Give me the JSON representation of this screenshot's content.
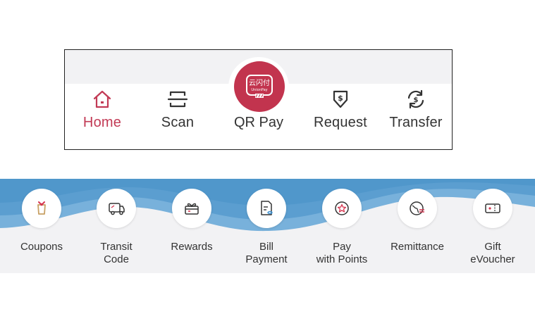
{
  "tabbar": {
    "tabs": [
      {
        "label": "Home"
      },
      {
        "label": "Scan"
      },
      {
        "label": "QR Pay",
        "logo_text": "云闪付",
        "logo_sub": "UnionPay"
      },
      {
        "label": "Request"
      },
      {
        "label": "Transfer"
      }
    ],
    "active_color": "#c23a55",
    "accent": "#c2344e"
  },
  "services": {
    "items": [
      {
        "label": "Coupons",
        "icon": "coupon-icon"
      },
      {
        "label": "Transit\nCode",
        "icon": "bus-icon"
      },
      {
        "label": "Rewards",
        "icon": "gift-box-icon"
      },
      {
        "label": "Bill\nPayment",
        "icon": "bill-icon"
      },
      {
        "label": "Pay\nwith Points",
        "icon": "star-icon"
      },
      {
        "label": "Remittance",
        "icon": "globe-icon"
      },
      {
        "label": "Gift\neVoucher",
        "icon": "voucher-icon"
      }
    ],
    "wave_color": "#5b9ed0"
  }
}
